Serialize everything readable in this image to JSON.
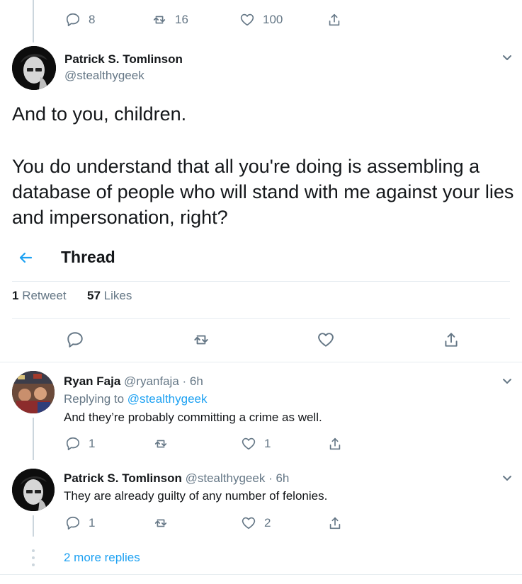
{
  "top_actions": {
    "reply_count": "8",
    "retweet_count": "16",
    "like_count": "100"
  },
  "main_tweet": {
    "name": "Patrick S. Tomlinson",
    "handle": "@stealthygeek",
    "line1": "And to you, children.",
    "line2": "You do understand that all you're doing is assembling a database of people who will stand with me against your lies and impersonation, right?"
  },
  "thread_header": {
    "title": "Thread"
  },
  "stats": {
    "retweets_num": "1",
    "retweets_label": "Retweet",
    "likes_num": "57",
    "likes_label": "Likes"
  },
  "replies": [
    {
      "name": "Ryan Faja",
      "handle": "@ryanfaja",
      "time": "· 6h",
      "replying_prefix": "Replying to",
      "replying_handle": "@stealthygeek",
      "text": "And they’re probably committing a crime as well.",
      "reply_count": "1",
      "like_count": "1"
    },
    {
      "name": "Patrick S. Tomlinson",
      "handle": "@stealthygeek",
      "time": "· 6h",
      "text": "They are already guilty of any number of felonies.",
      "reply_count": "1",
      "like_count": "2"
    }
  ],
  "more_replies": "2 more replies",
  "colors": {
    "accent": "#1da1f2",
    "muted": "#657786",
    "divider": "#e6ecf0"
  }
}
